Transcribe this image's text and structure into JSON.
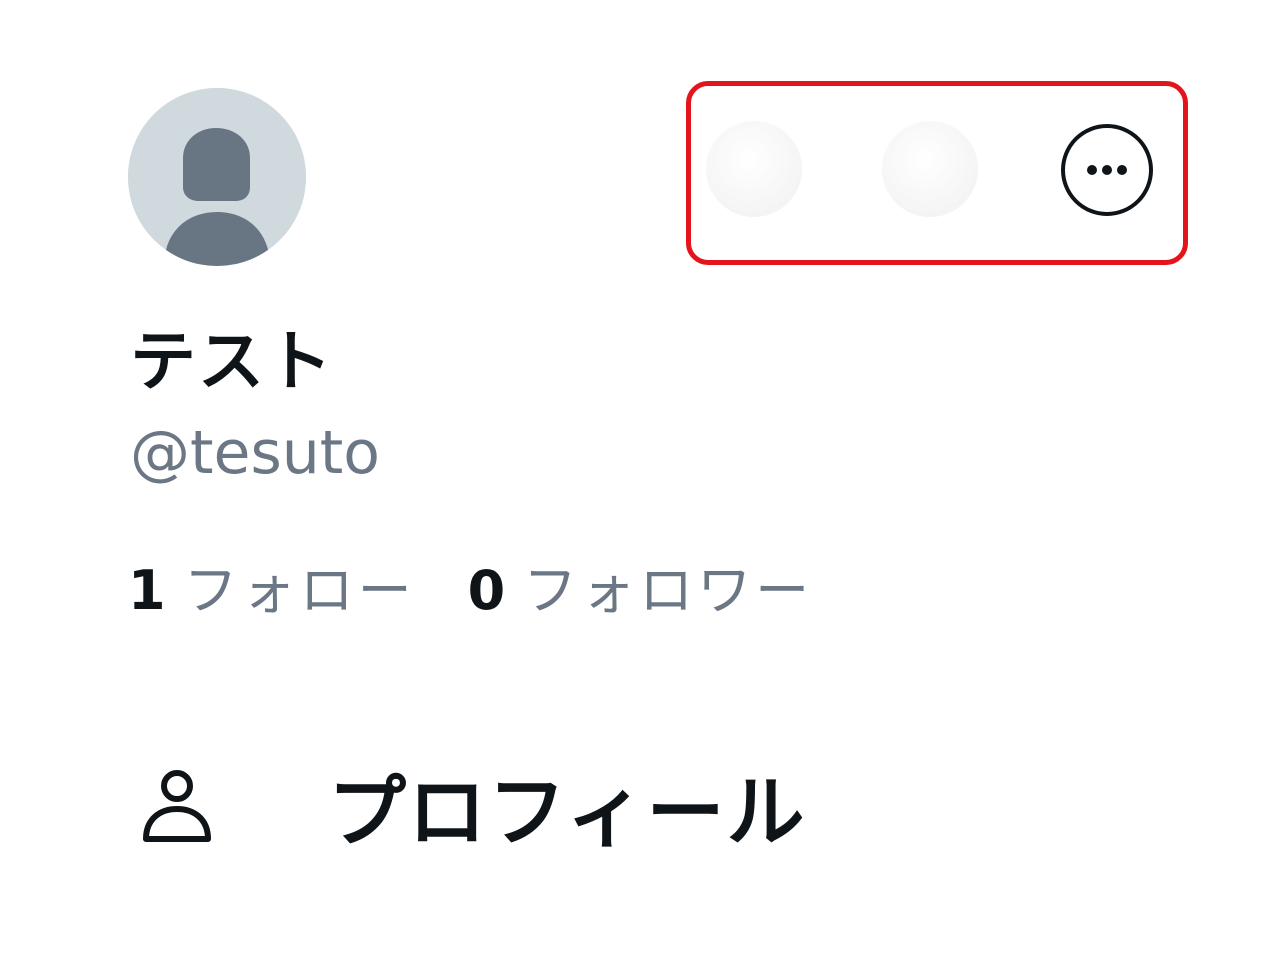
{
  "profile": {
    "display_name": "テスト",
    "handle": "@tesuto"
  },
  "stats": {
    "following": {
      "count": "1",
      "label": "フォロー"
    },
    "followers": {
      "count": "0",
      "label": "フォロワー"
    }
  },
  "menu": {
    "profile_label": "プロフィール"
  },
  "icons": {
    "avatar": "default-avatar-icon",
    "more": "more-options-icon",
    "profile": "person-icon"
  },
  "colors": {
    "highlight_border": "#e3141c",
    "avatar_bg": "#cfd9de",
    "avatar_fg": "#687684",
    "text_primary": "#0f1419",
    "text_secondary": "#6b7785"
  }
}
